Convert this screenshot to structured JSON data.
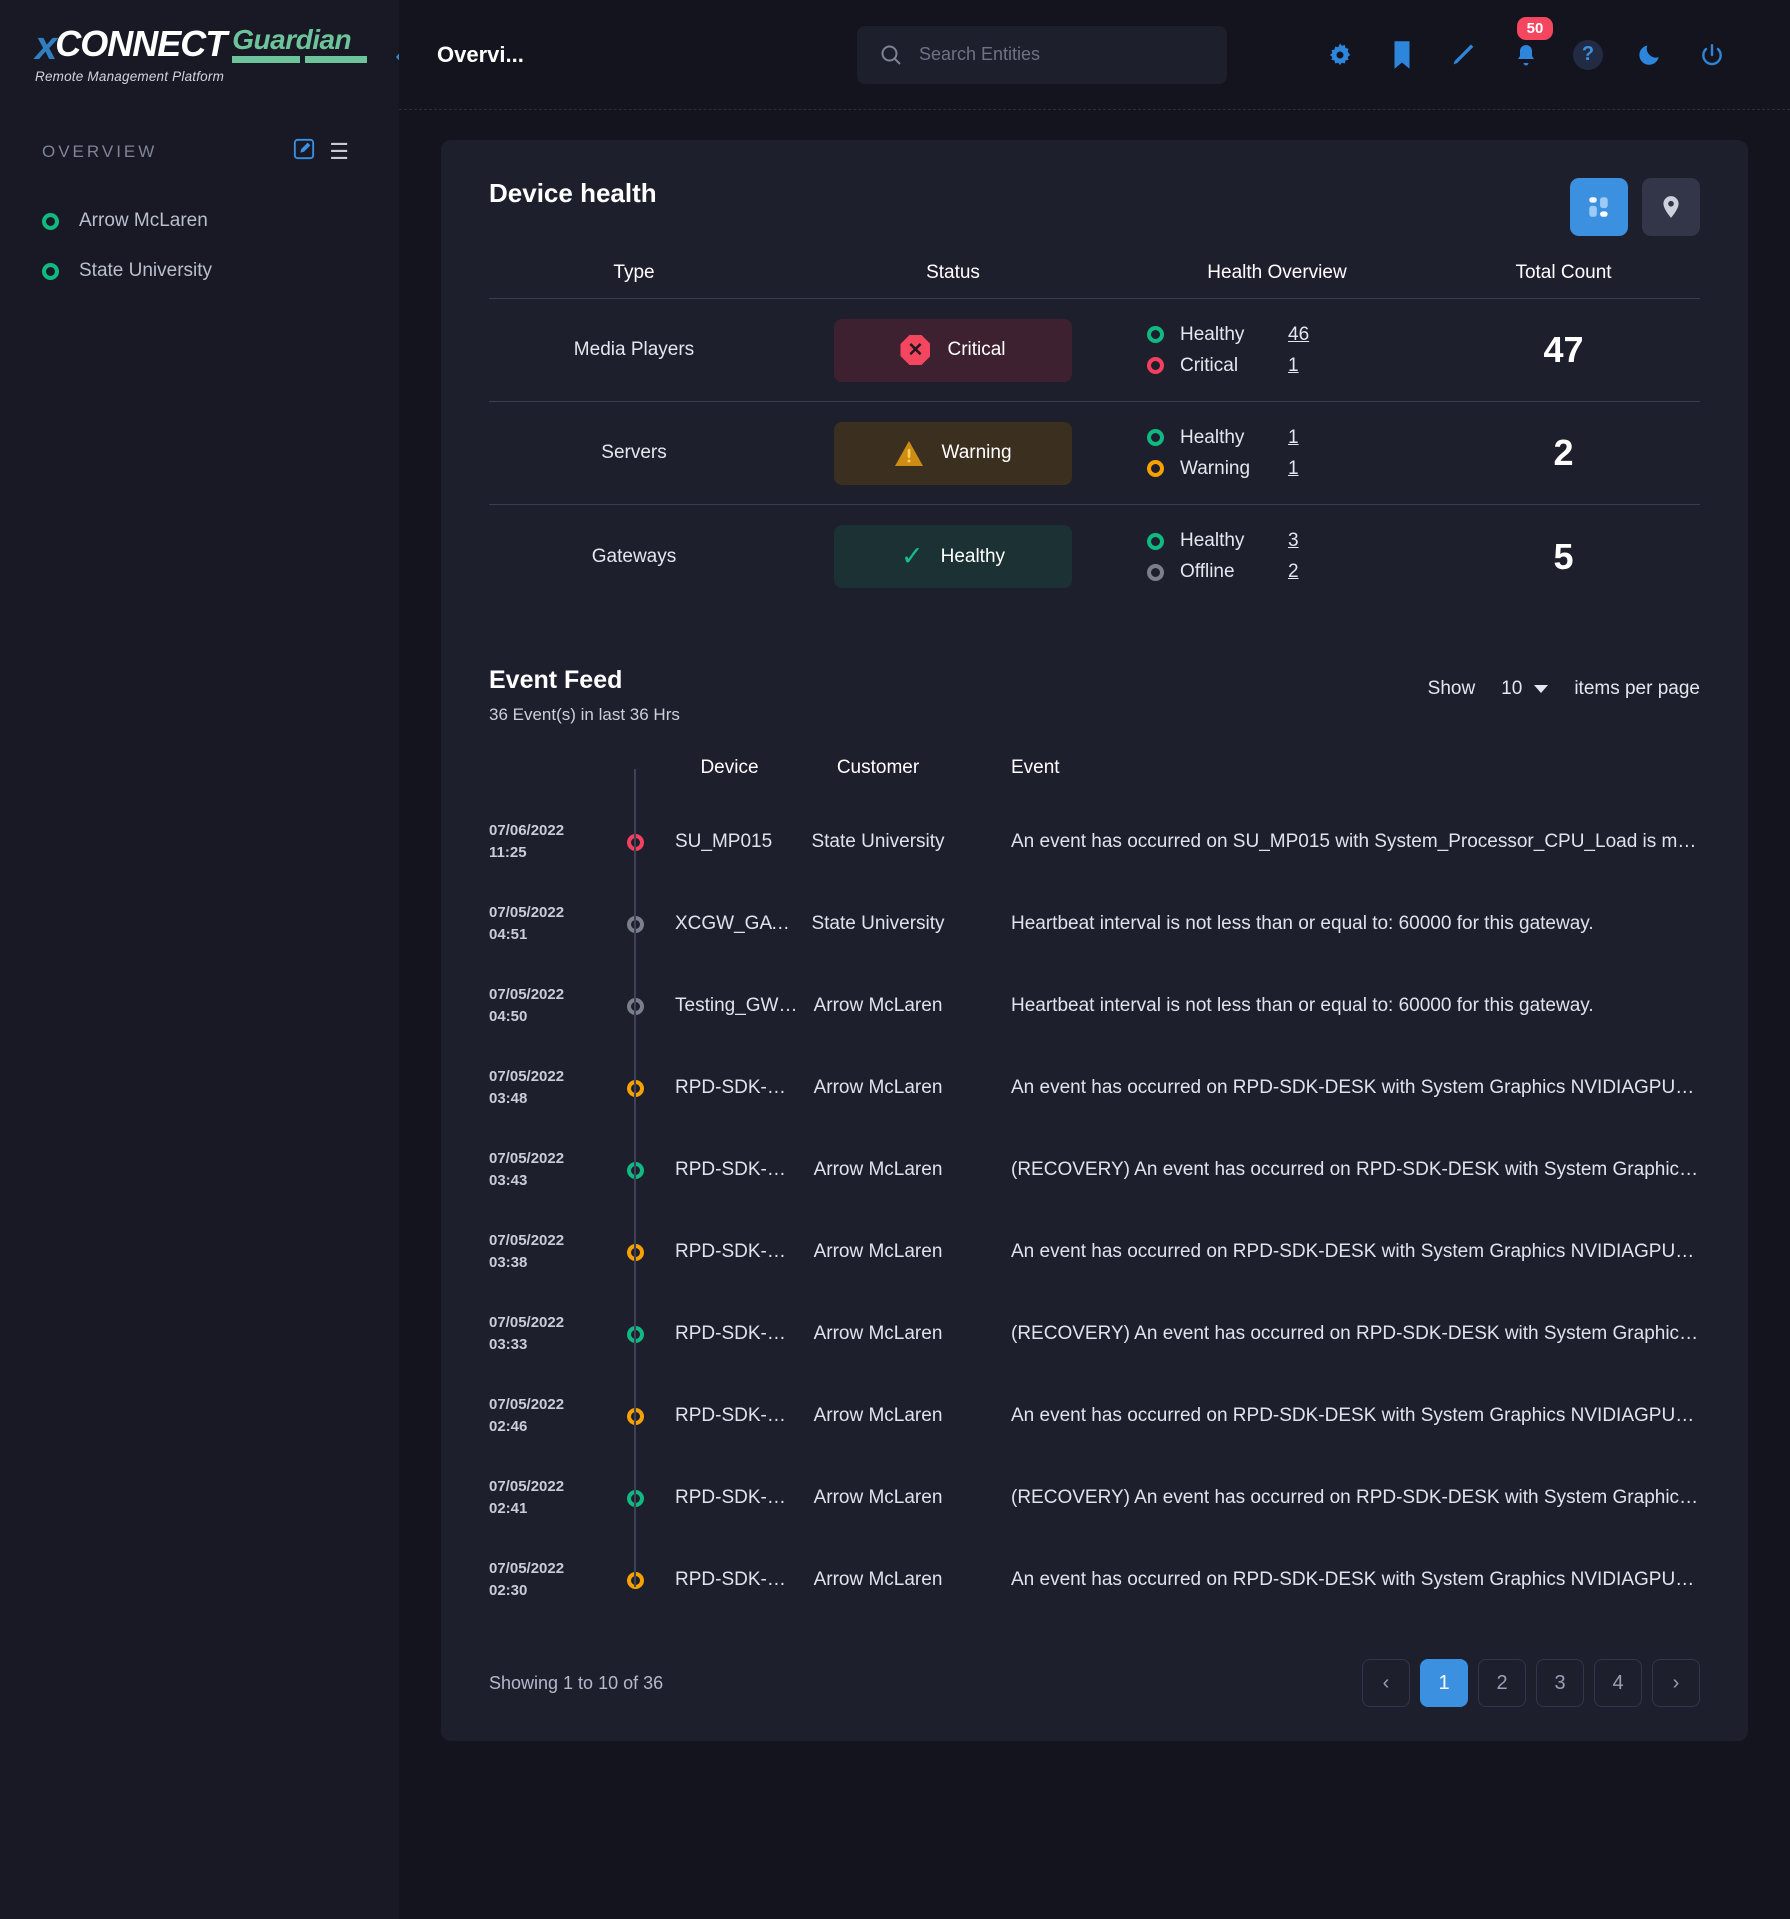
{
  "brand": {
    "x": "x",
    "connect": "CONNECT",
    "guardian": "Guardian",
    "tagline": "Remote Management Platform"
  },
  "sidebar": {
    "section_title": "OVERVIEW",
    "items": [
      {
        "label": "Arrow McLaren",
        "status": "green"
      },
      {
        "label": "State University",
        "status": "green"
      }
    ]
  },
  "topbar": {
    "page_title": "Overvi...",
    "search_placeholder": "Search Entities",
    "notification_badge": "50",
    "icons": [
      "gear-icon",
      "bookmark-icon",
      "pencil-icon",
      "bell-icon",
      "help-icon",
      "moon-icon",
      "power-icon"
    ]
  },
  "device_health": {
    "title": "Device health",
    "columns": [
      "Type",
      "Status",
      "Health Overview",
      "Total Count"
    ],
    "rows": [
      {
        "type": "Media Players",
        "status": "Critical",
        "status_kind": "critical",
        "health": [
          {
            "label": "Healthy",
            "count": "46",
            "color": "green"
          },
          {
            "label": "Critical",
            "count": "1",
            "color": "red"
          }
        ],
        "total": "47"
      },
      {
        "type": "Servers",
        "status": "Warning",
        "status_kind": "warning",
        "health": [
          {
            "label": "Healthy",
            "count": "1",
            "color": "green"
          },
          {
            "label": "Warning",
            "count": "1",
            "color": "orange"
          }
        ],
        "total": "2"
      },
      {
        "type": "Gateways",
        "status": "Healthy",
        "status_kind": "healthy",
        "health": [
          {
            "label": "Healthy",
            "count": "3",
            "color": "green"
          },
          {
            "label": "Offline",
            "count": "2",
            "color": "gray"
          }
        ],
        "total": "5"
      }
    ]
  },
  "event_feed": {
    "title": "Event Feed",
    "subtitle": "36 Event(s) in last 36 Hrs",
    "show_label": "Show",
    "page_size": "10",
    "items_per_page_label": "items per page",
    "columns": [
      "Device",
      "Customer",
      "Event"
    ],
    "rows": [
      {
        "date": "07/06/2022",
        "time": "11:25",
        "color": "red",
        "device": "SU_MP015",
        "customer": "State University",
        "event": "An event has occurred on SU_MP015 with System_Processor_CPU_Load is mo…"
      },
      {
        "date": "07/05/2022",
        "time": "04:51",
        "color": "gray",
        "device": "XCGW_GAT…",
        "customer": "State University",
        "event": "Heartbeat interval is not less than or equal to: 60000 for this gateway."
      },
      {
        "date": "07/05/2022",
        "time": "04:50",
        "color": "gray",
        "device": "Testing_GW_…",
        "customer": "Arrow McLaren",
        "event": "Heartbeat interval is not less than or equal to: 60000 for this gateway."
      },
      {
        "date": "07/05/2022",
        "time": "03:48",
        "color": "orange",
        "device": "RPD-SDK-D…",
        "customer": "Arrow McLaren",
        "event": "An event has occurred on RPD-SDK-DESK with System Graphics NVIDIAGPU0 …"
      },
      {
        "date": "07/05/2022",
        "time": "03:43",
        "color": "green",
        "device": "RPD-SDK-D…",
        "customer": "Arrow McLaren",
        "event": "(RECOVERY) An event has occurred on RPD-SDK-DESK with System Graphics…"
      },
      {
        "date": "07/05/2022",
        "time": "03:38",
        "color": "orange",
        "device": "RPD-SDK-D…",
        "customer": "Arrow McLaren",
        "event": "An event has occurred on RPD-SDK-DESK with System Graphics NVIDIAGPU0 …"
      },
      {
        "date": "07/05/2022",
        "time": "03:33",
        "color": "green",
        "device": "RPD-SDK-D…",
        "customer": "Arrow McLaren",
        "event": "(RECOVERY) An event has occurred on RPD-SDK-DESK with System Graphics…"
      },
      {
        "date": "07/05/2022",
        "time": "02:46",
        "color": "orange",
        "device": "RPD-SDK-D…",
        "customer": "Arrow McLaren",
        "event": "An event has occurred on RPD-SDK-DESK with System Graphics NVIDIAGPU0 …"
      },
      {
        "date": "07/05/2022",
        "time": "02:41",
        "color": "green",
        "device": "RPD-SDK-D…",
        "customer": "Arrow McLaren",
        "event": "(RECOVERY) An event has occurred on RPD-SDK-DESK with System Graphics…"
      },
      {
        "date": "07/05/2022",
        "time": "02:30",
        "color": "orange",
        "device": "RPD-SDK-D…",
        "customer": "Arrow McLaren",
        "event": "An event has occurred on RPD-SDK-DESK with System Graphics NVIDIAGPU0 …"
      }
    ],
    "showing_text": "Showing 1 to 10 of 36",
    "pages": [
      "1",
      "2",
      "3",
      "4"
    ],
    "active_page": "1"
  },
  "colors": {
    "accent": "#3b90e0",
    "green": "#0fb981",
    "red": "#f4475f",
    "orange": "#f5a100",
    "gray": "#7a7f8c",
    "card_bg": "#1e1f2c",
    "page_bg": "#14141f",
    "sidebar_bg": "#191925"
  }
}
